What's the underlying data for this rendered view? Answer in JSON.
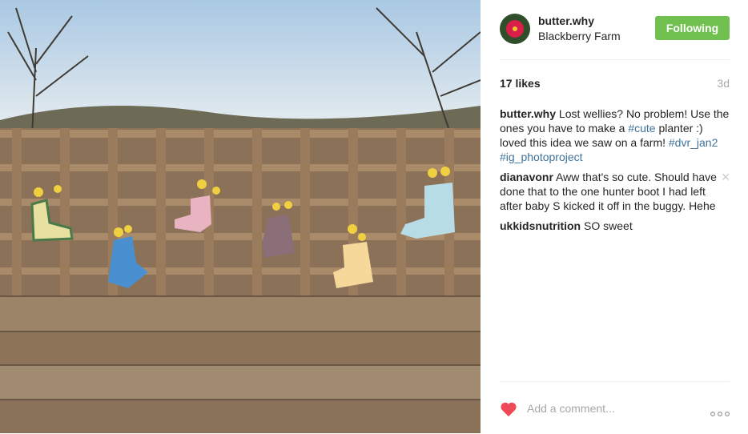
{
  "post": {
    "image_alt": "Wellies used as planters on a wooden farm fence",
    "author": "butter.why",
    "location": "Blackberry Farm",
    "follow_label": "Following",
    "likes": "17 likes",
    "time_ago": "3d",
    "caption": {
      "user": "butter.why",
      "text1": "Lost wellies? No problem! Use the ones you have to make a ",
      "tag1": "#cute",
      "text2": " planter :) loved this idea we saw on a farm! ",
      "tag2": "#dvr_jan2",
      "tag3": "#ig_photoproject"
    },
    "comments": [
      {
        "user": "dianavonr",
        "text": "Aww that's so cute. Should have done that to the one hunter boot I had left after baby S kicked it off in the buggy. Hehe"
      },
      {
        "user": "ukkidsnutrition",
        "text": "SO sweet"
      }
    ],
    "comment_placeholder": "Add a comment...",
    "accent_color": "#70c050",
    "link_color": "#3f729b",
    "heart_color": "#ed4956"
  }
}
